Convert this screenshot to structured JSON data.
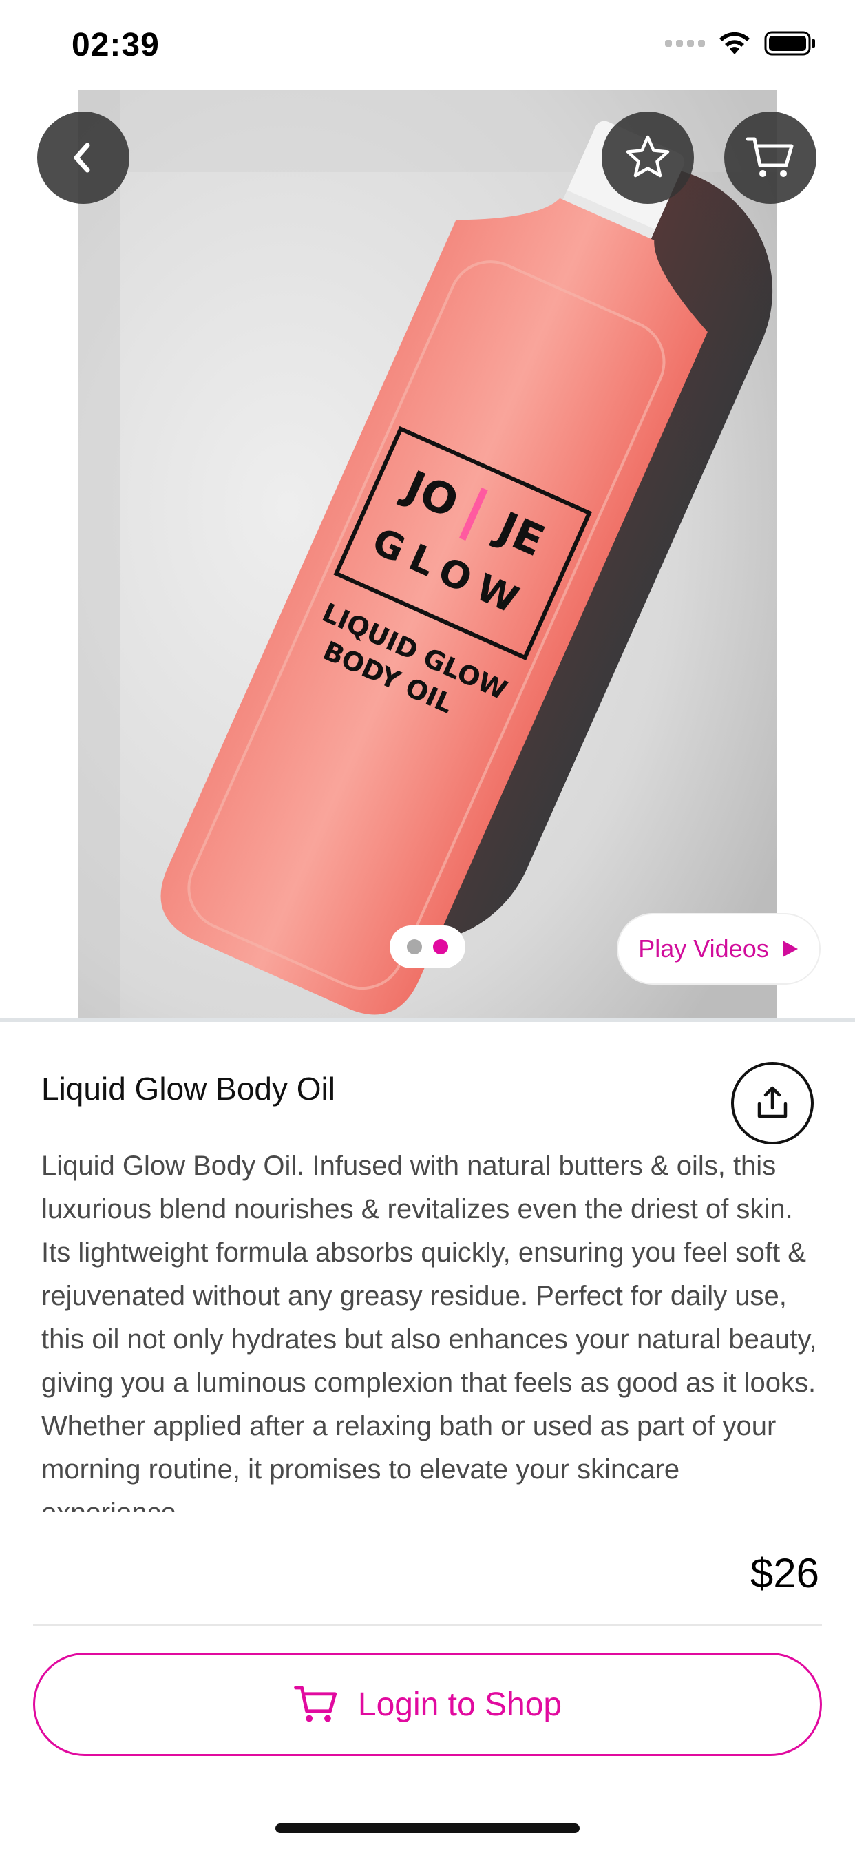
{
  "status_bar": {
    "time": "02:39",
    "icons": [
      "signal-icon",
      "wifi-icon",
      "battery-icon"
    ]
  },
  "media": {
    "photo_brand_text": [
      "JO",
      "JE",
      "GLOW"
    ],
    "photo_product_text": [
      "LIQUID GLOW",
      "BODY OIL"
    ],
    "pager": {
      "count": 2,
      "active_index": 1
    },
    "play_videos_label": "Play Videos",
    "top_buttons": [
      "back-icon",
      "star-icon",
      "cart-icon"
    ]
  },
  "product": {
    "title": "Liquid Glow Body Oil",
    "description": "Liquid Glow Body Oil. Infused with natural butters & oils, this luxurious blend nourishes & revitalizes even the driest of skin. Its lightweight formula absorbs quickly, ensuring you feel soft & rejuvenated without any greasy residue. Perfect for daily use, this oil not only hydrates but also enhances your natural beauty, giving you a luminous complexion that feels as good as it looks. Whether applied after a relaxing bath or used as part of your morning routine, it promises to elevate your skincare experience."
  },
  "purchase": {
    "price": "$26",
    "login_label": "Login to Shop"
  },
  "colors": {
    "accent": "#e10a9f",
    "text_primary": "#111111",
    "text_body": "#4a4a4a",
    "button_overlay": "#343434"
  }
}
